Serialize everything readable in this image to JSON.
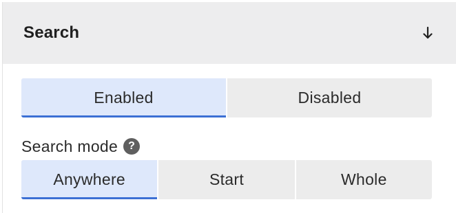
{
  "section": {
    "title": "Search",
    "collapse_icon": "arrow-down-icon"
  },
  "status_toggle": {
    "options": [
      "Enabled",
      "Disabled"
    ],
    "selected": "Enabled"
  },
  "search_mode": {
    "label": "Search mode",
    "help_icon": "question-circle-icon",
    "help_glyph": "?",
    "options": [
      "Anywhere",
      "Start",
      "Whole"
    ],
    "selected": "Anywhere"
  },
  "colors": {
    "header_bg": "#ededee",
    "segment_bg": "#ececec",
    "active_bg": "#dee8fb",
    "accent": "#3b6fd4"
  }
}
